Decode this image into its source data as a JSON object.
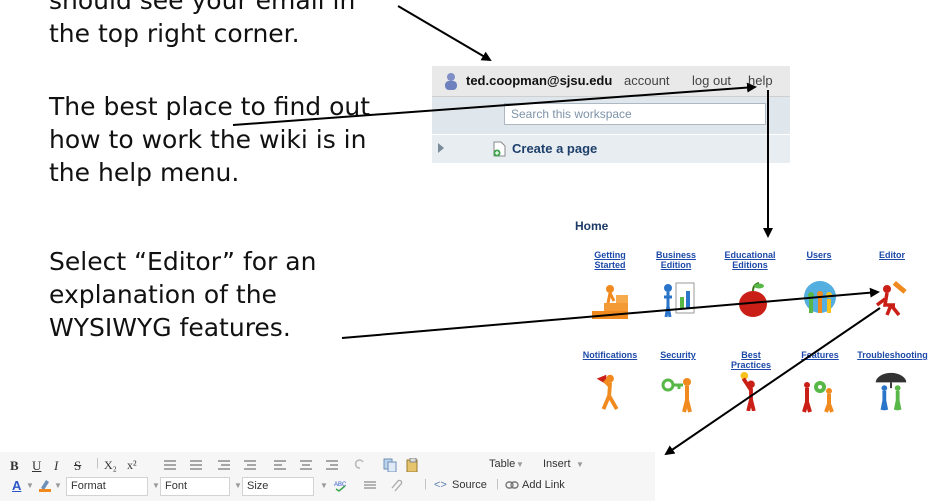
{
  "notes": {
    "first": "should see your email in\nthe top right corner.",
    "second": "The best place to find out\nhow to work the wiki is in\nthe help menu.",
    "third": "Select “Editor” for an\nexplanation of the\nWYSIWYG features."
  },
  "topbar": {
    "email": "ted.coopman@sjsu.edu",
    "links": [
      "account",
      "log out",
      "help"
    ]
  },
  "search": {
    "placeholder": "Search this workspace"
  },
  "sidebar": {
    "create_label": "Create a page"
  },
  "help": {
    "home": "Home",
    "row1": [
      "Getting Started",
      "Business\nEdition",
      "Educational\nEditions",
      "Users",
      "Editor"
    ],
    "row2": [
      "Notifications",
      "Security",
      "Best Practices",
      "Features",
      "Troubleshooting"
    ]
  },
  "toolbar": {
    "format": [
      "B",
      "U",
      "I",
      "S",
      "X₂",
      "x²"
    ],
    "table": "Table",
    "insert": "Insert",
    "selects": [
      "Format",
      "Font",
      "Size"
    ],
    "source": "Source",
    "add_link": "Add Link"
  },
  "colors": {
    "link": "#1c49a8",
    "orange": "#f08a1e",
    "red": "#c91f16"
  }
}
